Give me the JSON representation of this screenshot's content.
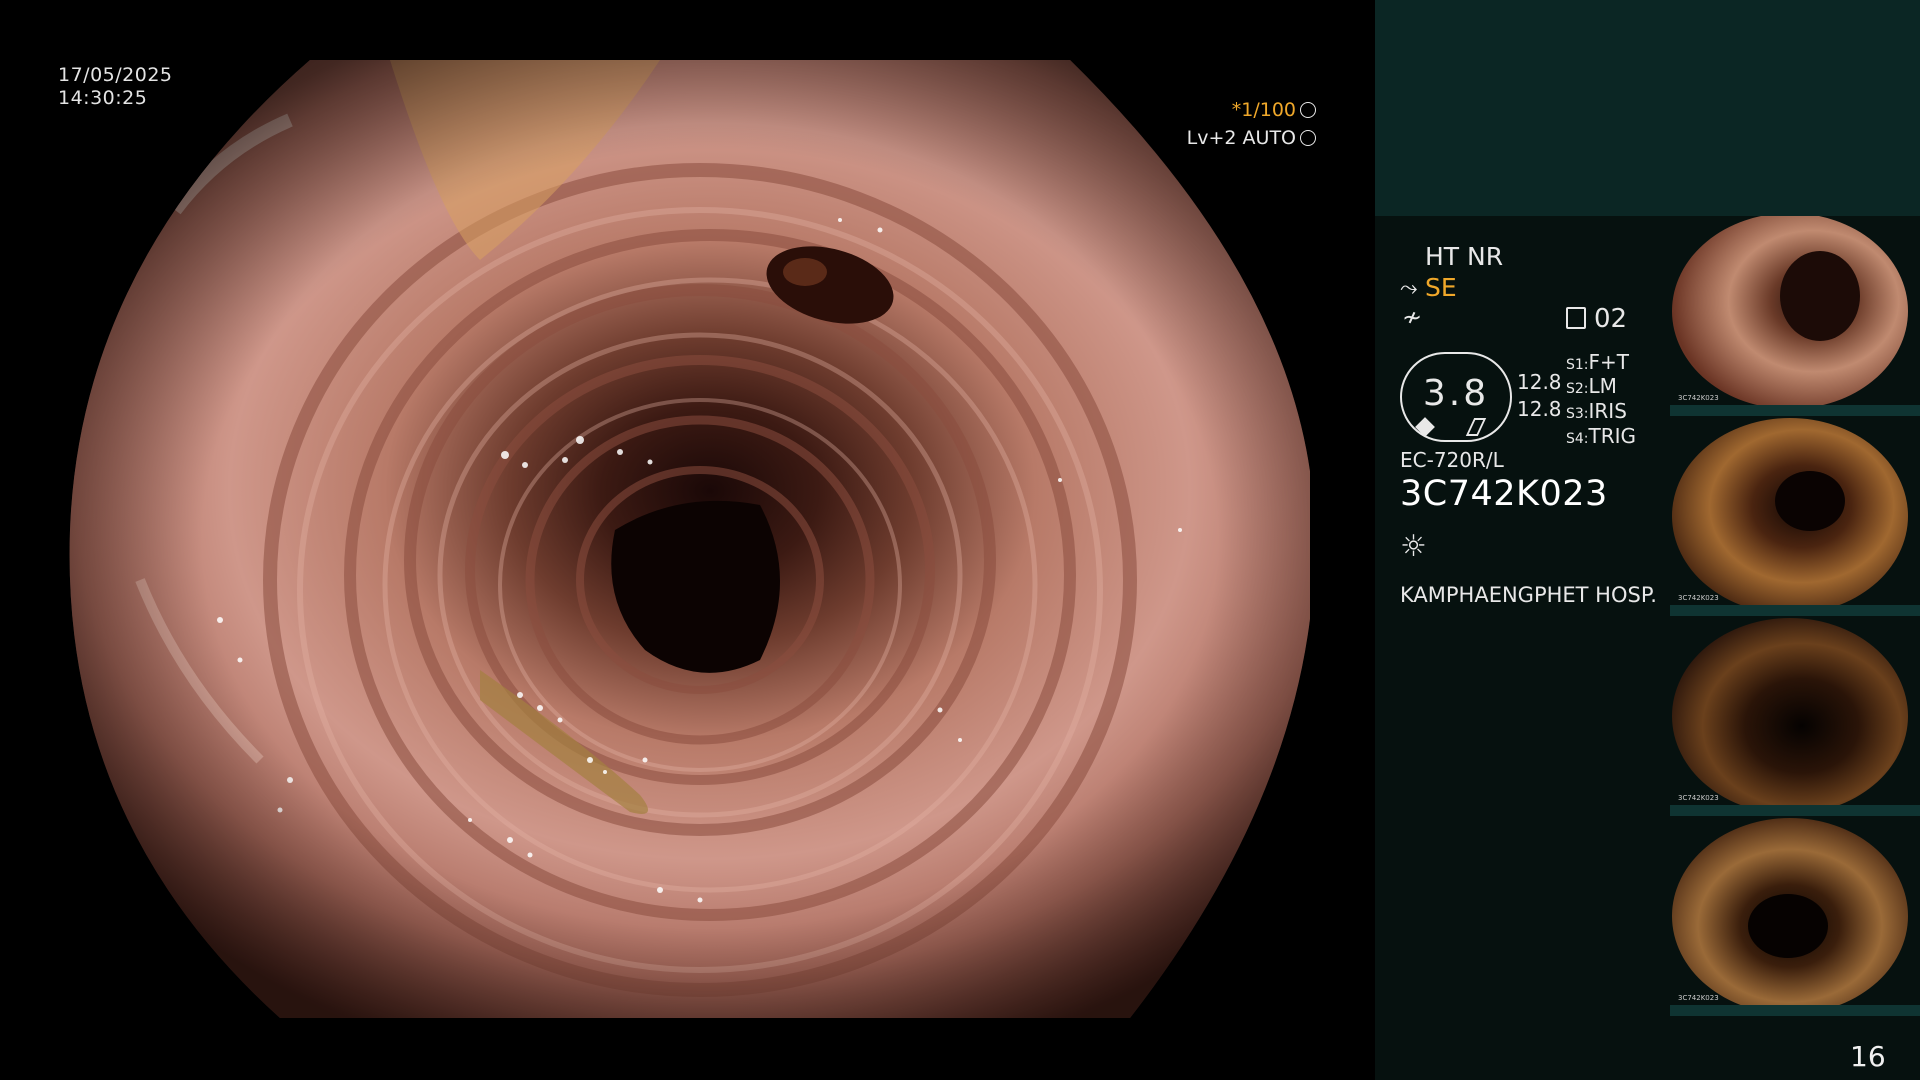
{
  "overlay": {
    "date": "17/05/2025",
    "time": "14:30:25",
    "shutter": "*1/100",
    "level": "Lv+2 AUTO"
  },
  "panel": {
    "ht_nr": "HT NR",
    "se": "SE",
    "video_channel": "02",
    "gauge_value": "3.8",
    "value_a": "12.8",
    "value_b": "12.8",
    "switches": [
      {
        "key": "S1",
        "value": "F+T"
      },
      {
        "key": "S2",
        "value": "LM"
      },
      {
        "key": "S3",
        "value": "IRIS"
      },
      {
        "key": "S4",
        "value": "TRIG"
      }
    ],
    "scope_model": "EC-720R/L",
    "serial": "3C742K023",
    "hospital": "KAMPHAENGPHET HOSP."
  },
  "thumbnails": [
    {
      "serial": "3C742K023",
      "tone": "light"
    },
    {
      "serial": "3C742K023",
      "tone": "mid"
    },
    {
      "serial": "3C742K023",
      "tone": "dark"
    },
    {
      "serial": "3C742K023",
      "tone": "warm"
    }
  ],
  "page_number": "16",
  "colors": {
    "accent": "#f0a82a",
    "panel_bg": "#06110f",
    "panel_top": "#0b2624"
  }
}
